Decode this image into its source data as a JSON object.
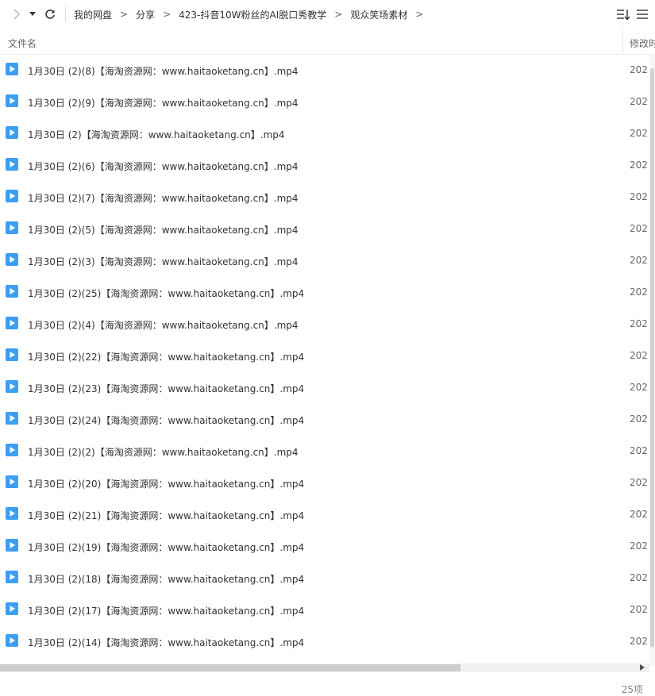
{
  "toolbar": {
    "breadcrumbs": [
      "我的网盘",
      "分享",
      "423-抖音10W粉丝的AI脱口秀教学",
      "观众笑场素材"
    ]
  },
  "columns": {
    "name": "文件名",
    "modified": "修改时"
  },
  "files": [
    {
      "name": "1月30日 (2)(8)【海淘资源网：www.haitaoketang.cn】.mp4",
      "date": "202"
    },
    {
      "name": "1月30日 (2)(9)【海淘资源网：www.haitaoketang.cn】.mp4",
      "date": "202"
    },
    {
      "name": "1月30日 (2)【海淘资源网：www.haitaoketang.cn】.mp4",
      "date": "202"
    },
    {
      "name": "1月30日 (2)(6)【海淘资源网：www.haitaoketang.cn】.mp4",
      "date": "202"
    },
    {
      "name": "1月30日 (2)(7)【海淘资源网：www.haitaoketang.cn】.mp4",
      "date": "202"
    },
    {
      "name": "1月30日 (2)(5)【海淘资源网：www.haitaoketang.cn】.mp4",
      "date": "202"
    },
    {
      "name": "1月30日 (2)(3)【海淘资源网：www.haitaoketang.cn】.mp4",
      "date": "202"
    },
    {
      "name": "1月30日 (2)(25)【海淘资源网：www.haitaoketang.cn】.mp4",
      "date": "202"
    },
    {
      "name": "1月30日 (2)(4)【海淘资源网：www.haitaoketang.cn】.mp4",
      "date": "202"
    },
    {
      "name": "1月30日 (2)(22)【海淘资源网：www.haitaoketang.cn】.mp4",
      "date": "202"
    },
    {
      "name": "1月30日 (2)(23)【海淘资源网：www.haitaoketang.cn】.mp4",
      "date": "202"
    },
    {
      "name": "1月30日 (2)(24)【海淘资源网：www.haitaoketang.cn】.mp4",
      "date": "202"
    },
    {
      "name": "1月30日 (2)(2)【海淘资源网：www.haitaoketang.cn】.mp4",
      "date": "202"
    },
    {
      "name": "1月30日 (2)(20)【海淘资源网：www.haitaoketang.cn】.mp4",
      "date": "202"
    },
    {
      "name": "1月30日 (2)(21)【海淘资源网：www.haitaoketang.cn】.mp4",
      "date": "202"
    },
    {
      "name": "1月30日 (2)(19)【海淘资源网：www.haitaoketang.cn】.mp4",
      "date": "202"
    },
    {
      "name": "1月30日 (2)(18)【海淘资源网：www.haitaoketang.cn】.mp4",
      "date": "202"
    },
    {
      "name": "1月30日 (2)(17)【海淘资源网：www.haitaoketang.cn】.mp4",
      "date": "202"
    },
    {
      "name": "1月30日 (2)(14)【海淘资源网：www.haitaoketang.cn】.mp4",
      "date": "202"
    }
  ],
  "status": {
    "count": "25项"
  },
  "colors": {
    "video_icon": "#3d9ef5",
    "text": "#333333"
  }
}
